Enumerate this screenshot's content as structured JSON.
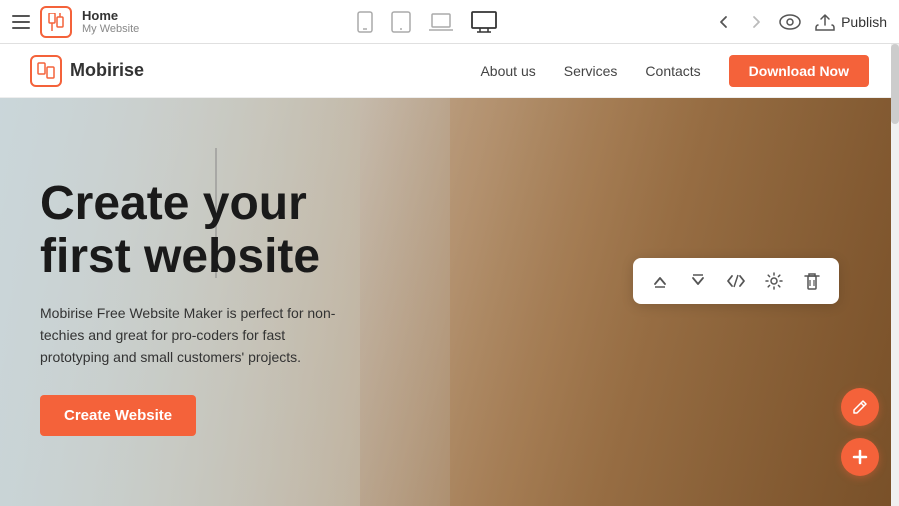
{
  "toolbar": {
    "hamburger_label": "☰",
    "app_icon_label": "📱",
    "home_title": "Home",
    "home_subtitle": "My Website",
    "devices": [
      {
        "name": "mobile",
        "icon": "phone",
        "active": false
      },
      {
        "name": "tablet",
        "icon": "tablet",
        "active": false
      },
      {
        "name": "laptop",
        "icon": "laptop",
        "active": false
      },
      {
        "name": "desktop",
        "icon": "desktop",
        "active": true
      }
    ],
    "back_label": "←",
    "forward_label": "→",
    "eye_label": "👁",
    "publish_label": "Publish"
  },
  "site_navbar": {
    "logo_text": "Mobirise",
    "nav_links": [
      {
        "label": "About us"
      },
      {
        "label": "Services"
      },
      {
        "label": "Contacts"
      }
    ],
    "cta_button": "Download Now"
  },
  "hero": {
    "title_line1": "Create your",
    "title_line2": "first website",
    "description": "Mobirise Free Website Maker is perfect for non-techies and great for pro-coders for fast prototyping and small customers' projects.",
    "cta_button": "Create Website"
  },
  "float_toolbar": {
    "up_icon": "↑",
    "down_icon": "↓",
    "code_icon": "</>",
    "settings_icon": "⚙",
    "delete_icon": "🗑"
  },
  "fabs": {
    "edit_icon": "✎",
    "add_icon": "+"
  },
  "colors": {
    "accent": "#f4623a",
    "text_dark": "#1a1a1a",
    "text_mid": "#444",
    "text_light": "#888",
    "bg_white": "#ffffff"
  }
}
